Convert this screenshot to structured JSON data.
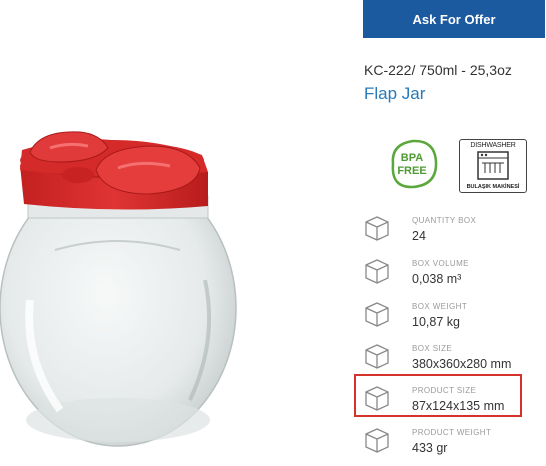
{
  "offer_button": {
    "label": "Ask For Offer"
  },
  "product": {
    "code": "KC-222/ 750ml - 25,3oz",
    "name": "Flap Jar"
  },
  "badges": {
    "bpa_free": {
      "line1": "BPA",
      "line2": "FREE",
      "icon": "bpa-free-leaf-icon"
    },
    "dishwasher": {
      "title": "DISHWASHER",
      "subtitle": "BULAŞIK MAKİNESİ",
      "icon": "dishwasher-icon"
    }
  },
  "specs": [
    {
      "label": "QUANTITY BOX",
      "value": "24",
      "icon": "box-icon"
    },
    {
      "label": "BOX VOLUME",
      "value": "0,038 m³",
      "icon": "box-icon"
    },
    {
      "label": "BOX WEIGHT",
      "value": "10,87 kg",
      "icon": "box-icon"
    },
    {
      "label": "BOX SIZE",
      "value": "380x360x280 mm",
      "icon": "box-icon"
    },
    {
      "label": "PRODUCT SIZE",
      "value": "87x124x135 mm",
      "icon": "box-icon",
      "highlighted": true
    },
    {
      "label": "PRODUCT WEIGHT",
      "value": "433 gr",
      "icon": "box-icon"
    }
  ],
  "colors": {
    "button_bg": "#1c5aa0",
    "name_text": "#2979b8",
    "lid_red": "#d42a2a",
    "bpa_green": "#5aa83c",
    "highlight_border": "#d5322b"
  }
}
